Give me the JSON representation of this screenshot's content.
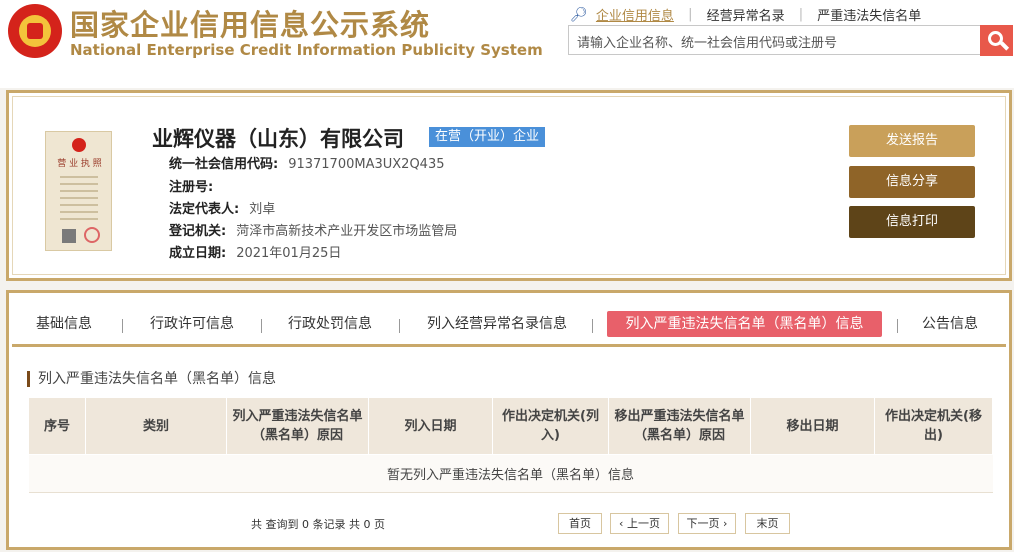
{
  "header": {
    "title": "国家企业信用信息公示系统",
    "subtitle": "National Enterprise Credit Information Publicity System",
    "links": [
      "企业信用信息",
      "经营异常名录",
      "严重违法失信名单"
    ],
    "search_placeholder": "请输入企业名称、统一社会信用代码或注册号"
  },
  "company": {
    "name": "业辉仪器（山东）有限公司",
    "status": "在营（开业）企业",
    "license_title": "营 业 执 照",
    "fields": [
      {
        "label": "统一社会信用代码:",
        "value": "91371700MA3UX2Q435"
      },
      {
        "label": "注册号:",
        "value": ""
      },
      {
        "label": "法定代表人:",
        "value": "刘卓"
      },
      {
        "label": "登记机关:",
        "value": "菏泽市高新技术产业开发区市场监管局"
      },
      {
        "label": "成立日期:",
        "value": "2021年01月25日"
      }
    ],
    "actions": [
      "发送报告",
      "信息分享",
      "信息打印"
    ]
  },
  "tabs": [
    "基础信息",
    "行政许可信息",
    "行政处罚信息",
    "列入经营异常名录信息",
    "列入严重违法失信名单（黑名单）信息",
    "公告信息"
  ],
  "active_tab": "列入严重违法失信名单（黑名单）信息",
  "section": {
    "title": "列入严重违法失信名单（黑名单）信息",
    "columns": [
      "序号",
      "类别",
      "列入严重违法失信名单（黑名单）原因",
      "列入日期",
      "作出决定机关(列入)",
      "移出严重违法失信名单（黑名单）原因",
      "移出日期",
      "作出决定机关(移出)"
    ],
    "empty_text": "暂无列入严重违法失信名单（黑名单）信息"
  },
  "pager": {
    "summary": "共 查询到 0 条记录 共 0 页",
    "first": "首页",
    "prev": "‹ 上一页",
    "next": "下一页 ›",
    "last": "末页"
  },
  "colors": {
    "brand_gold": "#b08945",
    "border_gold": "#c9a86a",
    "active_tab": "#e8606a",
    "status_blue": "#4a90d9",
    "btn_send": "#c9a05a",
    "btn_share": "#8f6428",
    "btn_print": "#5e4418"
  }
}
